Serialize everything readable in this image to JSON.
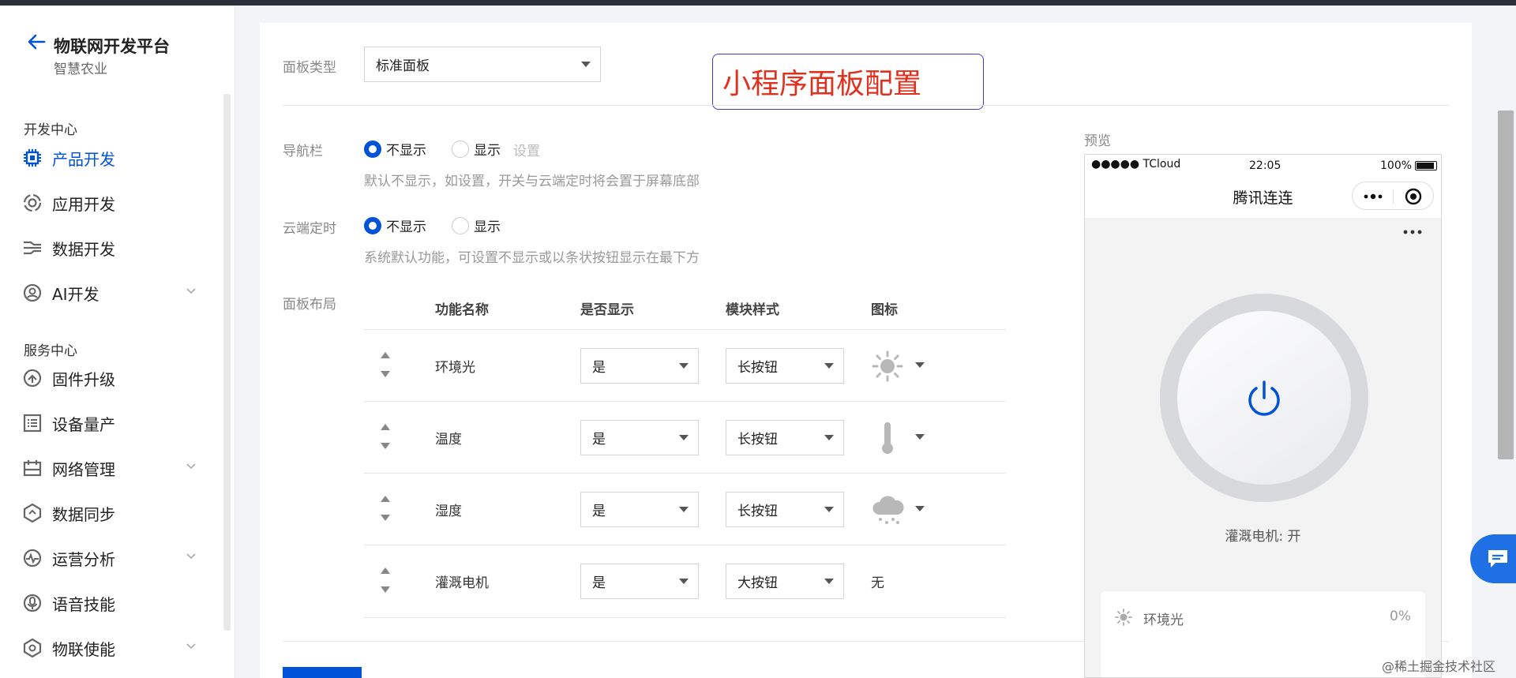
{
  "sidebar": {
    "title": "物联网开发平台",
    "subtitle": "智慧农业",
    "group_dev": "开发中心",
    "group_service": "服务中心",
    "items": [
      {
        "label": "产品开发"
      },
      {
        "label": "应用开发"
      },
      {
        "label": "数据开发"
      },
      {
        "label": "AI开发"
      },
      {
        "label": "固件升级"
      },
      {
        "label": "设备量产"
      },
      {
        "label": "网络管理"
      },
      {
        "label": "数据同步"
      },
      {
        "label": "运营分析"
      },
      {
        "label": "语音技能"
      },
      {
        "label": "物联使能"
      }
    ]
  },
  "panel": {
    "type_label": "面板类型",
    "type_value": "标准面板",
    "annotation": "小程序面板配置",
    "nav_label": "导航栏",
    "nav_hide": "不显示",
    "nav_show": "显示",
    "nav_setting": "设置",
    "nav_hint": "默认不显示，如设置，开关与云端定时将会置于屏幕底部",
    "timer_label": "云端定时",
    "timer_hide": "不显示",
    "timer_show": "显示",
    "timer_hint": "系统默认功能，可设置不显示或以条状按钮显示在最下方",
    "layout_label": "面板布局",
    "columns": [
      "功能名称",
      "是否显示",
      "模块样式",
      "图标"
    ],
    "rows": [
      {
        "name": "环境光",
        "show": "是",
        "style": "长按钮",
        "icon": "sun-icon"
      },
      {
        "name": "温度",
        "show": "是",
        "style": "长按钮",
        "icon": "thermometer-icon"
      },
      {
        "name": "湿度",
        "show": "是",
        "style": "长按钮",
        "icon": "cloud-rain-icon"
      },
      {
        "name": "灌溉电机",
        "show": "是",
        "style": "大按钮",
        "icon_text": "无"
      }
    ]
  },
  "preview": {
    "label": "预览",
    "carrier": "●●●●● TCloud",
    "time": "22:05",
    "battery": "100%",
    "title": "腾讯连连",
    "power_label": "灌溉电机: 开",
    "list": [
      {
        "name": "环境光",
        "value": "0%"
      }
    ]
  },
  "watermark": "@稀土掘金技术社区",
  "colors": {
    "accent": "#0052d9",
    "annotation_red": "#e0301e"
  }
}
